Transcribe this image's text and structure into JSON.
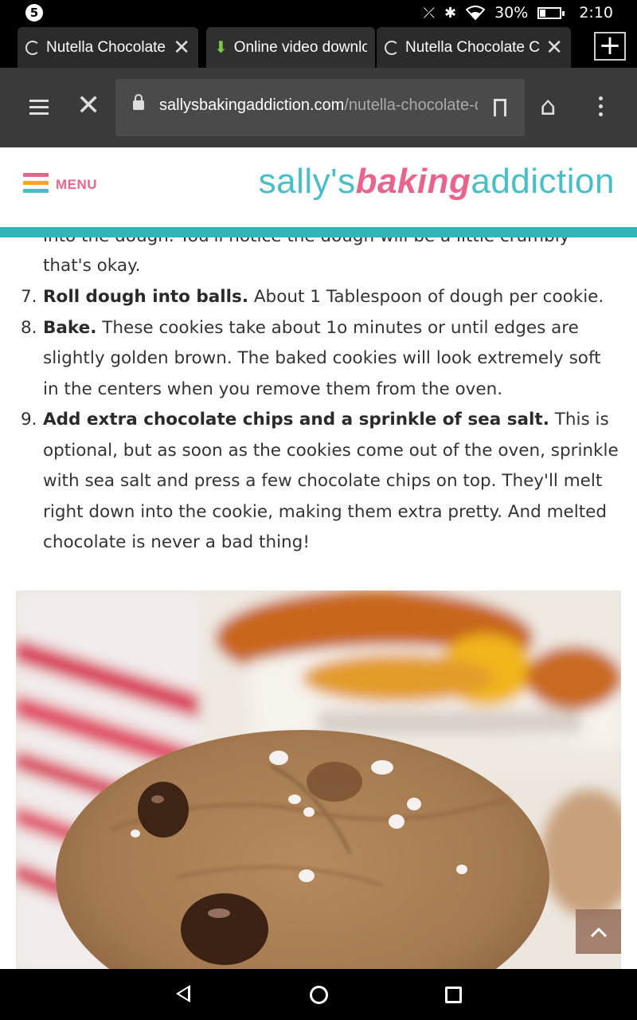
{
  "status_bar": {
    "notification_count": "5",
    "battery": "30%",
    "battery_level": 0.3,
    "time": "2:10"
  },
  "tabs": [
    {
      "title": "Nutella Chocolate Chip Cookies",
      "state": "loading"
    },
    {
      "title": "Online video downloader",
      "state": "download"
    },
    {
      "title": "Nutella Chocolate Chip Cookies",
      "state": "loading"
    }
  ],
  "toolbar": {
    "url_domain": "sallysbakingaddiction.com",
    "url_path": "/nutella-chocolate-chip-cookies/"
  },
  "site": {
    "menu_label": "MENU",
    "logo_part1": "sally's",
    "logo_part2": "baking",
    "logo_part3": "addiction",
    "menu_colors": [
      "#e9648c",
      "#f5a623",
      "#47bfc8"
    ]
  },
  "article": {
    "cut_line": "into the dough. You'll notice the dough will be a little crumbly –",
    "cont_line": "that's okay.",
    "steps": [
      {
        "num": "7.",
        "bold": "Roll dough into balls.",
        "text": " About 1 Tablespoon of dough per cookie."
      },
      {
        "num": "8.",
        "bold": "Bake.",
        "text": " These cookies take about 1o minutes or until edges are slightly golden brown. The baked cookies will look extremely soft in the centers when you remove them from the oven."
      },
      {
        "num": "9.",
        "bold": "Add extra chocolate chips and a sprinkle of sea salt.",
        "text": " This is optional, but as soon as the cookies come out of the oven, sprinkle with sea salt and press a few chocolate chips on top. They'll melt right down into the cookie, making them extra pretty. And melted chocolate is never a bad thing!"
      }
    ]
  }
}
